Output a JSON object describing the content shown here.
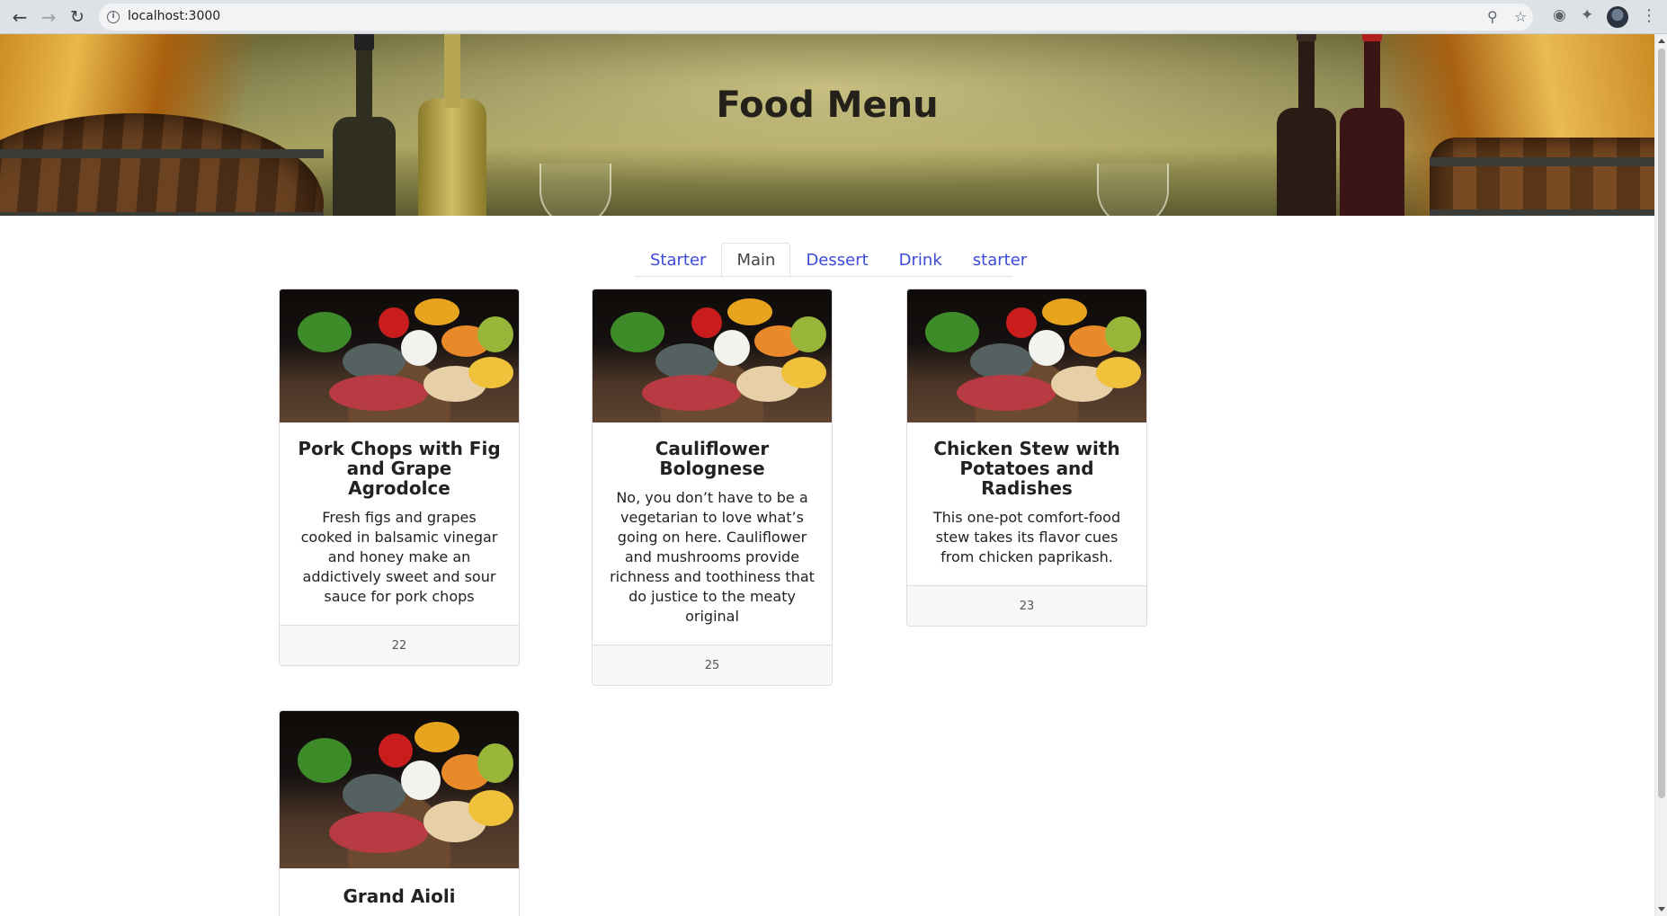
{
  "browser": {
    "url": "localhost:3000",
    "back_icon": "arrow-left",
    "forward_icon": "arrow-right",
    "reload_icon": "reload",
    "zoom_icon": "magnifier",
    "bookmark_icon": "star",
    "extensions": [
      "extension-badge",
      "puzzle"
    ],
    "menu_icon": "three-dots"
  },
  "hero": {
    "title": "Food Menu"
  },
  "tabs": [
    {
      "label": "Starter",
      "active": false
    },
    {
      "label": "Main",
      "active": true
    },
    {
      "label": "Dessert",
      "active": false
    },
    {
      "label": "Drink",
      "active": false
    },
    {
      "label": "starter",
      "active": false
    }
  ],
  "cards": [
    {
      "title": "Pork Chops with Fig and Grape Agrodolce",
      "description": "Fresh figs and grapes cooked in balsamic vinegar and honey make an addictively sweet and sour sauce for pork chops",
      "price": "22"
    },
    {
      "title": "Cauliflower Bolognese",
      "description": "No, you don’t have to be a vegetarian to love what’s going on here. Cauliflower and mushrooms provide richness and toothiness that do justice to the meaty original",
      "price": "25"
    },
    {
      "title": "Chicken Stew with Potatoes and Radishes",
      "description": "This one-pot comfort-food stew takes its flavor cues from chicken paprikash.",
      "price": "23"
    },
    {
      "title": "Grand Aioli",
      "description": "",
      "price": ""
    }
  ]
}
